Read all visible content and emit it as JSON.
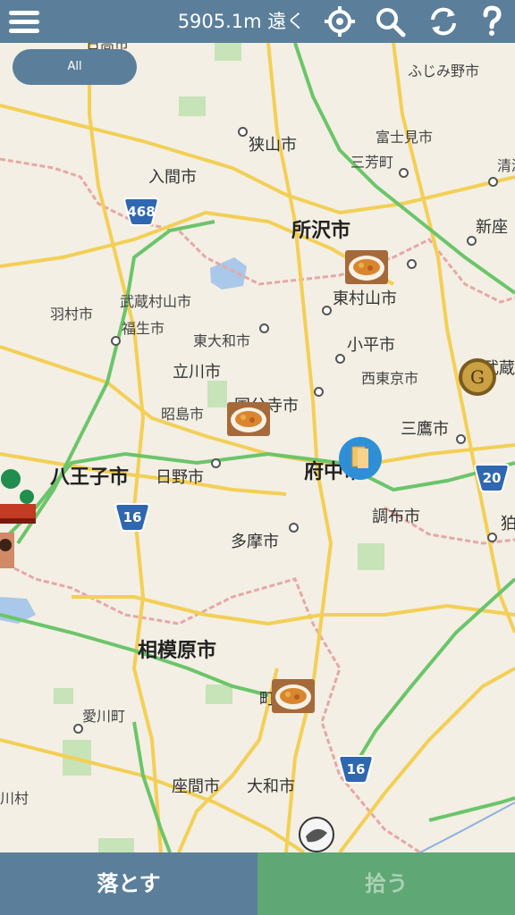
{
  "header": {
    "distance_label": "5905.1m 遠く",
    "menu_icon": "menu-icon",
    "locate_icon": "crosshair-icon",
    "search_icon": "search-icon",
    "refresh_icon": "refresh-icon",
    "help_icon": "help-icon",
    "color": "#5b7f9a"
  },
  "filter": {
    "label": "All"
  },
  "map": {
    "places_big": [
      "所沢市",
      "八王子市",
      "府中市",
      "相模原市"
    ],
    "places_mid": [
      "狭山市",
      "入間市",
      "東村山市",
      "小平市",
      "立川市",
      "国分寺市",
      "三鷹市",
      "多摩市",
      "調布市",
      "日野市",
      "大和市",
      "座間市",
      "町田市",
      "新座",
      "武蔵",
      "狛"
    ],
    "places_sm": [
      "ふじみ野市",
      "富士見市",
      "三芳町",
      "武蔵村山市",
      "羽村市",
      "福生市",
      "東大和市",
      "西東京市",
      "昭島市",
      "愛川町",
      "川村",
      "日高市",
      "清瀬"
    ],
    "route_numbers": [
      "468",
      "16",
      "20",
      "16"
    ]
  },
  "actions": {
    "drop_label": "落とす",
    "pick_label": "拾う",
    "drop_color": "#5b7f9a",
    "pick_color": "#5fa774"
  }
}
